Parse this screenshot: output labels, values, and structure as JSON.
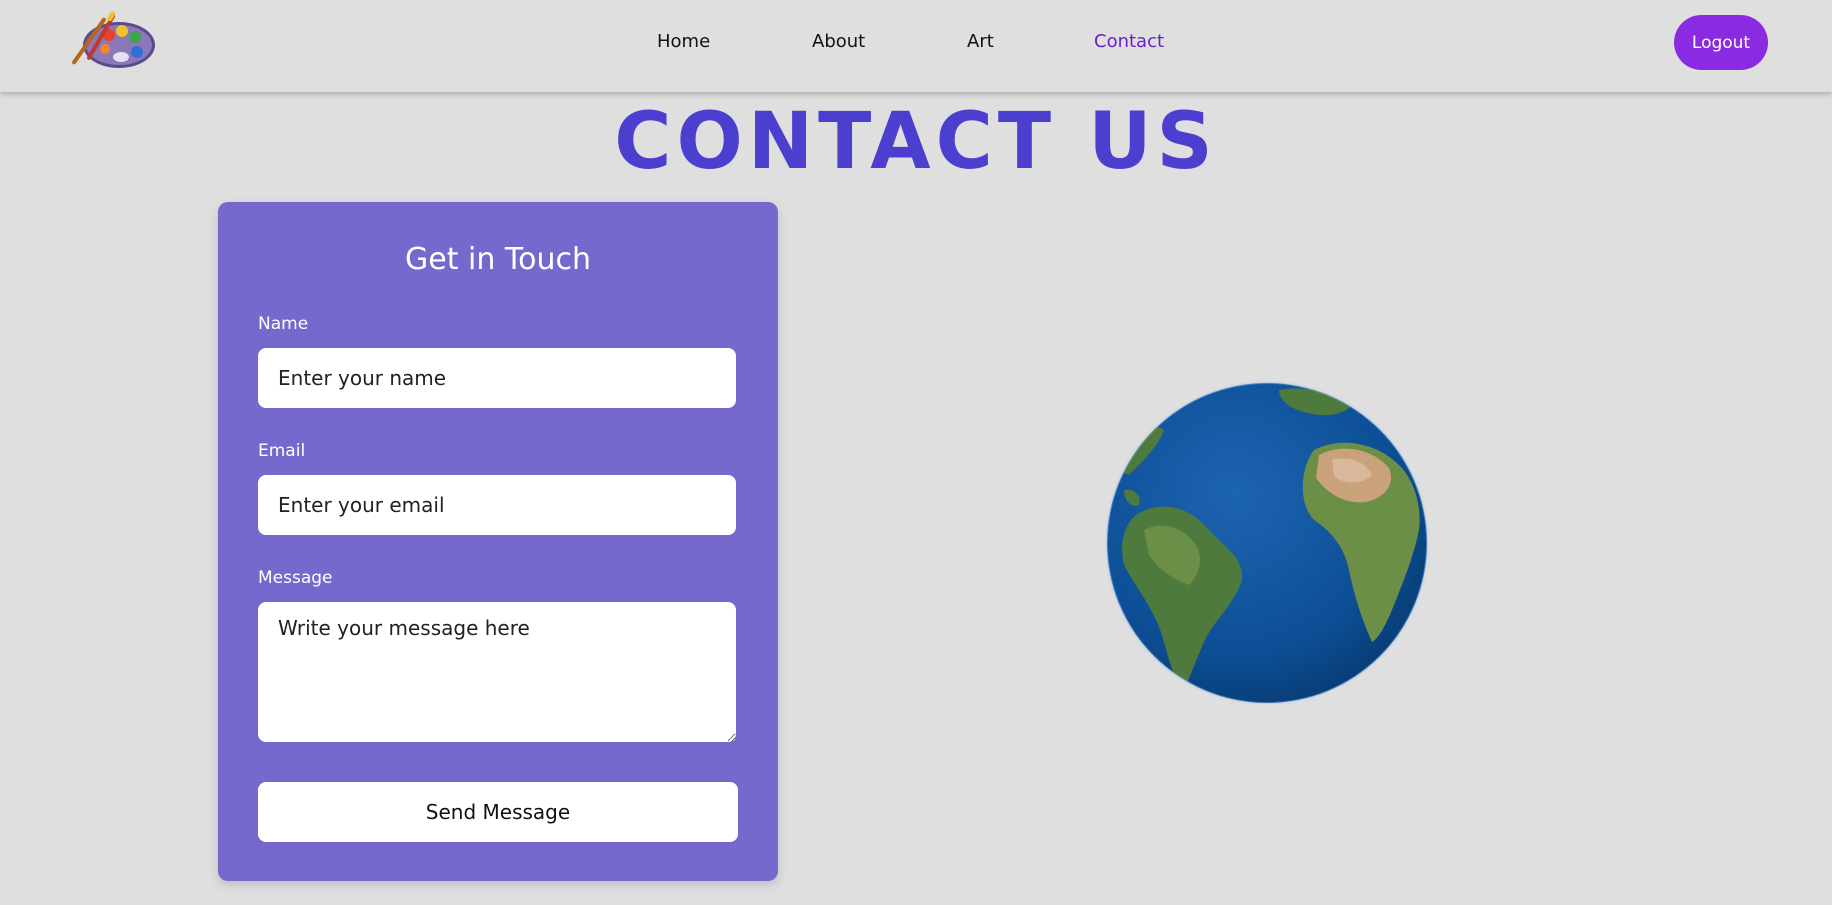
{
  "nav": {
    "links": [
      {
        "label": "Home"
      },
      {
        "label": "About"
      },
      {
        "label": "Art"
      },
      {
        "label": "Contact"
      }
    ],
    "active": "Contact",
    "logout_label": "Logout",
    "logo_icon": "paint-palette-icon"
  },
  "page": {
    "title": "CONTACT US"
  },
  "form": {
    "title": "Get in Touch",
    "name_label": "Name",
    "name_placeholder": "Enter your name",
    "email_label": "Email",
    "email_placeholder": "Enter your email",
    "message_label": "Message",
    "message_placeholder": "Write your message here",
    "submit_label": "Send Message"
  },
  "globe": {
    "icon": "earth-globe-icon"
  },
  "colors": {
    "background": "#dfdfdf",
    "accent": "#8a2be2",
    "title": "#4c3fd0",
    "card": "#7569cd",
    "active_link": "#6b21c8"
  }
}
